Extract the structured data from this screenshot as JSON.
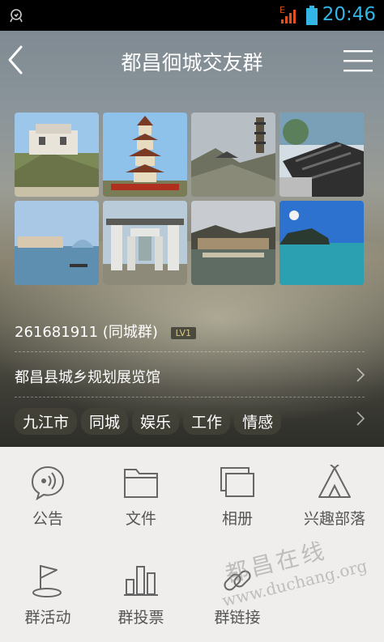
{
  "status_bar": {
    "time": "20:46",
    "network": "E"
  },
  "header": {
    "title": "都昌徊城交友群"
  },
  "group": {
    "id_line": "261681911 (同城群)",
    "level": "LV1",
    "location": "都昌县城乡规划展览馆",
    "tags": [
      "九江市",
      "同城",
      "娱乐",
      "工作",
      "情感"
    ]
  },
  "photos": [
    "photo-1",
    "photo-2",
    "photo-3",
    "photo-4",
    "photo-5",
    "photo-6",
    "photo-7",
    "photo-8"
  ],
  "actions": [
    {
      "label": "公告",
      "icon": "announcement-icon"
    },
    {
      "label": "文件",
      "icon": "folder-icon"
    },
    {
      "label": "相册",
      "icon": "album-icon"
    },
    {
      "label": "兴趣部落",
      "icon": "tent-icon"
    },
    {
      "label": "群活动",
      "icon": "flag-icon"
    },
    {
      "label": "群投票",
      "icon": "bar-chart-icon"
    },
    {
      "label": "群链接",
      "icon": "link-icon"
    }
  ],
  "watermark": {
    "cn": "都昌在线",
    "url": "www.duchang.org"
  },
  "colors": {
    "status_text": "#33b5e5",
    "status_alert": "#e05020",
    "icon_gray": "#666666"
  }
}
